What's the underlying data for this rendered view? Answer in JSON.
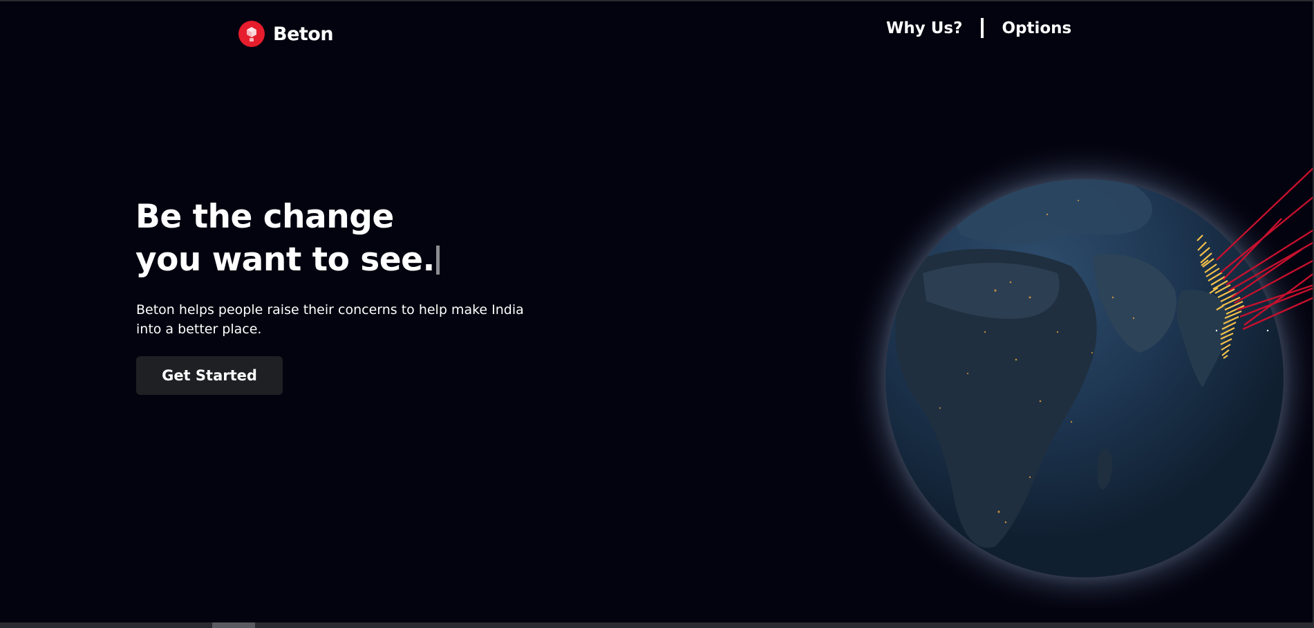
{
  "header": {
    "brand": "Beton",
    "nav": [
      {
        "label": "Why Us?"
      },
      {
        "label": "Options"
      }
    ]
  },
  "hero": {
    "title_line1": "Be the change",
    "title_line2": "you want to see.",
    "subtitle_line1": "Beton helps people raise their concerns to help make India",
    "subtitle_line2": "into a better place.",
    "cta_label": "Get Started"
  },
  "colors": {
    "background": "#03030f",
    "brand_red": "#e51d2c",
    "button_bg": "#1f2024",
    "arc_red": "#c8102e",
    "bar_yellow": "#f3c04a"
  },
  "icons": {
    "logo": "beton-logo-icon",
    "globe": "globe-visualization"
  }
}
